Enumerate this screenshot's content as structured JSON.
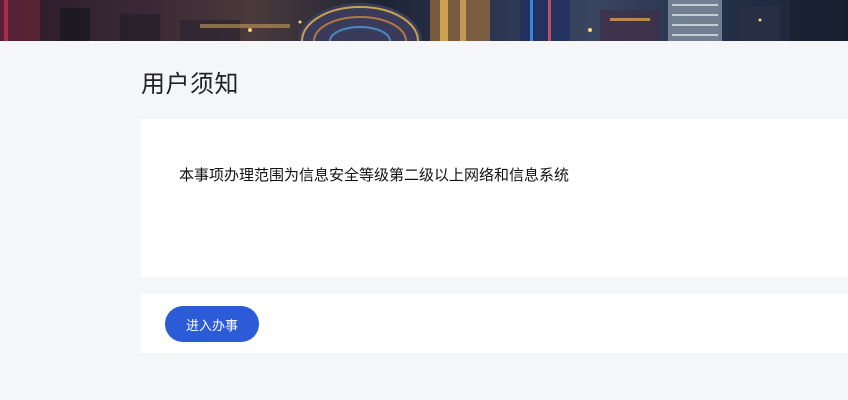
{
  "page": {
    "title": "用户须知"
  },
  "notice": {
    "text": "本事项办理范围为信息安全等级第二级以上网络和信息系统"
  },
  "actions": {
    "enter_label": "进入办事"
  },
  "colors": {
    "page_background": "#f5f6f8",
    "card_background": "#ffffff",
    "primary_button": "#2b5bd7"
  }
}
